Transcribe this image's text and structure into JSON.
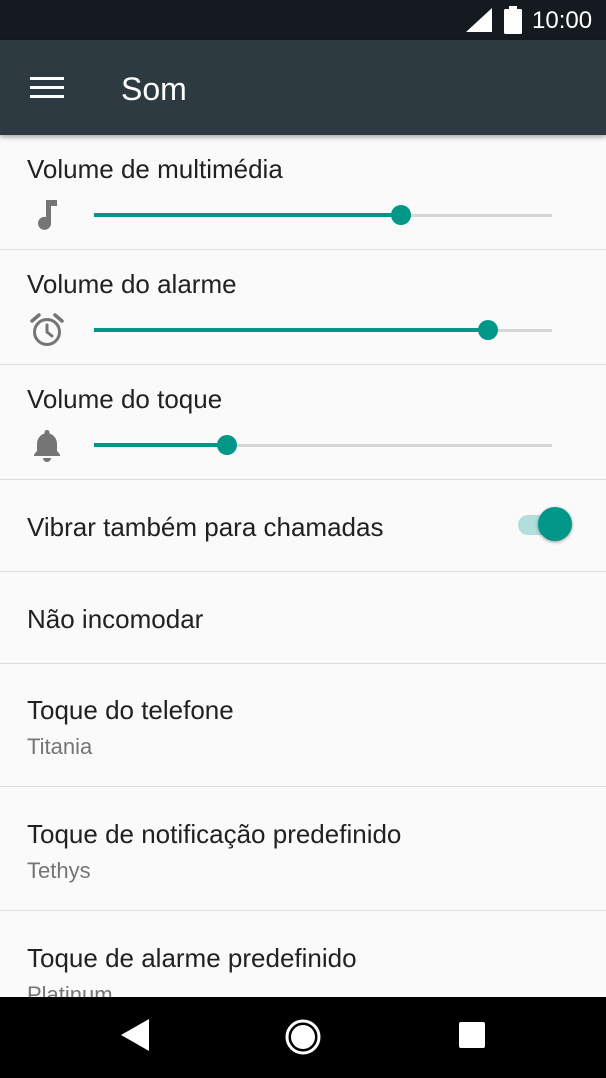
{
  "status_bar": {
    "time": "10:00",
    "icons": [
      "signal-icon",
      "battery-icon"
    ]
  },
  "app_bar": {
    "title": "Som",
    "menu_icon": "menu-icon"
  },
  "volumes": [
    {
      "label": "Volume de multimédia",
      "icon": "music-note-icon",
      "level": 0.67
    },
    {
      "label": "Volume do alarme",
      "icon": "alarm-clock-icon",
      "level": 0.86
    },
    {
      "label": "Volume do toque",
      "icon": "bell-icon",
      "level": 0.29
    }
  ],
  "vibrate": {
    "label": "Vibrar também para chamadas",
    "enabled": true
  },
  "dnd": {
    "label": "Não incomodar"
  },
  "ringtones": [
    {
      "label": "Toque do telefone",
      "value": "Titania"
    },
    {
      "label": "Toque de notificação predefinido",
      "value": "Tethys"
    },
    {
      "label": "Toque de alarme predefinido",
      "value": "Platinum"
    }
  ],
  "colors": {
    "accent": "#009688",
    "app_bar": "#2d3b41",
    "status_bar": "#141a1f"
  },
  "nav_bar": {
    "icons": [
      "back-icon",
      "home-icon",
      "recents-icon"
    ]
  }
}
